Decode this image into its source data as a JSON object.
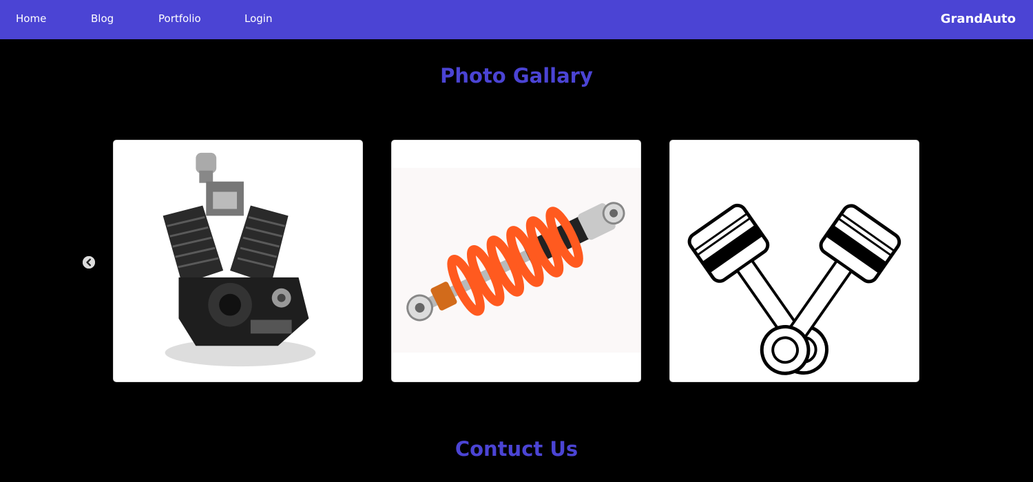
{
  "nav": {
    "links": [
      "Home",
      "Blog",
      "Portfolio",
      "Login"
    ],
    "brand": "GrandAuto"
  },
  "gallery": {
    "title": "Photo Gallary",
    "images": [
      {
        "subject": "motorcycle-engine"
      },
      {
        "subject": "shock-absorber"
      },
      {
        "subject": "crossed-pistons"
      }
    ],
    "prev_icon": "chevron-left-circle-icon"
  },
  "contact": {
    "title": "Contuct Us"
  },
  "colors": {
    "nav_bg": "#4b44d4",
    "accent": "#4b44d4",
    "page_bg": "#000000",
    "spring": "#ff5a1f"
  }
}
